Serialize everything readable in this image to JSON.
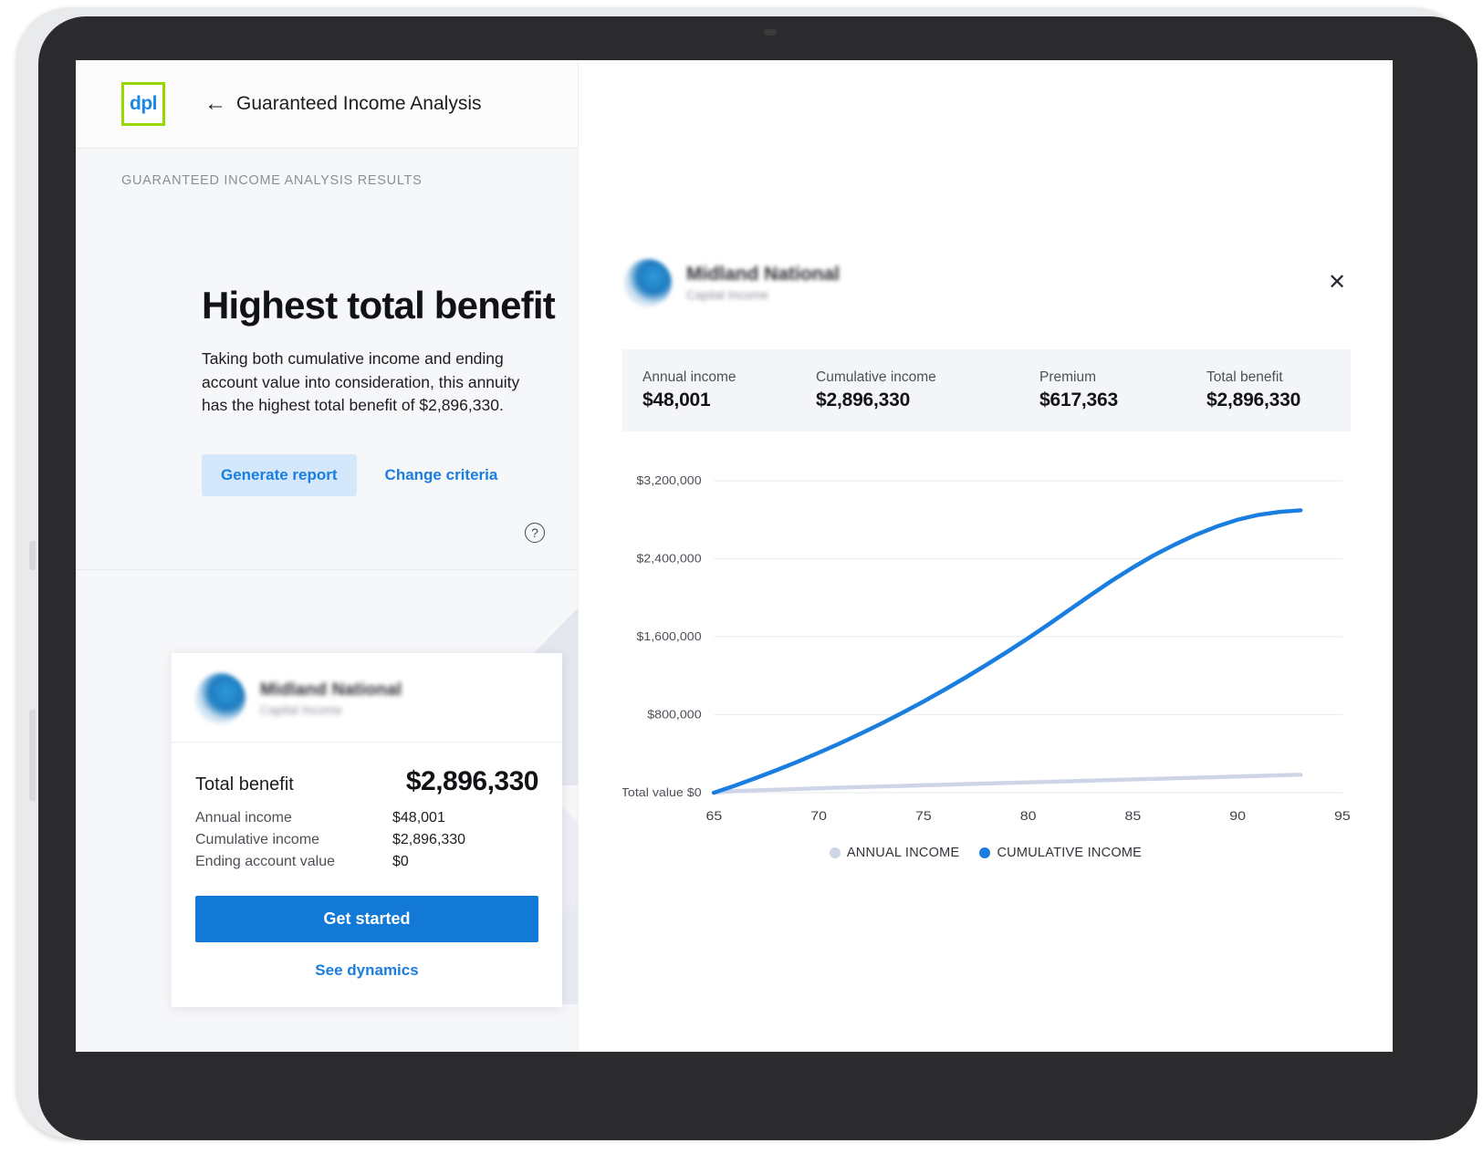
{
  "app": {
    "logo_text": "dpl",
    "back_icon": "arrow-left-icon",
    "title": "Guaranteed Income Analysis",
    "section_label": "GUARANTEED INCOME ANALYSIS RESULTS"
  },
  "hero": {
    "title": "Highest total benefit",
    "description": "Taking both cumulative income and ending account value into consideration, this annuity has the highest total benefit of $2,896,330.",
    "primary_button": "Generate report",
    "secondary_button": "Change criteria",
    "help_icon": "question-mark-icon",
    "help_glyph": "?"
  },
  "product_card": {
    "carrier_name": "Midland National",
    "product_name": "Capital Income",
    "total_label": "Total benefit",
    "total_value": "$2,896,330",
    "rows": [
      {
        "label": "Annual income",
        "value": "$48,001"
      },
      {
        "label": "Cumulative income",
        "value": "$2,896,330"
      },
      {
        "label": "Ending account value",
        "value": "$0"
      }
    ],
    "get_started_label": "Get started",
    "see_dynamics_label": "See dynamics"
  },
  "detail_panel": {
    "close_icon": "close-icon",
    "close_glyph": "✕",
    "carrier_name": "Midland National",
    "product_name": "Capital Income",
    "stats": [
      {
        "label": "Annual income",
        "value": "$48,001"
      },
      {
        "label": "Cumulative income",
        "value": "$2,896,330"
      },
      {
        "label": "Premium",
        "value": "$617,363"
      },
      {
        "label": "Total benefit",
        "value": "$2,896,330"
      }
    ]
  },
  "colors": {
    "accent_blue": "#1279d6",
    "link_blue": "#1a7ee0",
    "pill_blue_bg": "#d4e7fb",
    "logo_green": "#97d700",
    "cumulative_line": "#1a7ee0",
    "annual_line": "#cdd5e6",
    "panel_bg": "#f6f7f9",
    "stats_bg": "#f4f5f8"
  },
  "chart_data": {
    "type": "line",
    "title": "",
    "xlabel": "",
    "ylabel": "",
    "x": [
      65,
      66,
      67,
      68,
      69,
      70,
      71,
      72,
      73,
      74,
      75,
      76,
      77,
      78,
      79,
      80,
      81,
      82,
      83,
      84,
      85,
      86,
      87,
      88,
      89,
      90,
      91,
      92,
      93
    ],
    "xlim": [
      65,
      95
    ],
    "xticks": [
      65,
      70,
      75,
      80,
      85,
      90,
      95
    ],
    "xtick_labels": [
      "65",
      "70",
      "75",
      "80",
      "85",
      "90",
      "95"
    ],
    "ylim": [
      0,
      3200000
    ],
    "yticks": [
      0,
      800000,
      1600000,
      2400000,
      3200000
    ],
    "ytick_labels": [
      "Total value $0",
      "$800,000",
      "$1,600,000",
      "$2,400,000",
      "$3,200,000"
    ],
    "grid": true,
    "legend_position": "bottom",
    "series": [
      {
        "name": "ANNUAL INCOME",
        "color": "#cdd5e6",
        "values": [
          0,
          17000,
          24000,
          31000,
          38000,
          45000,
          52000,
          58000,
          64000,
          70000,
          76000,
          82000,
          88000,
          94000,
          100000,
          106000,
          112000,
          118000,
          124000,
          130000,
          136000,
          142000,
          148000,
          154000,
          160000,
          166000,
          172000,
          178000,
          184000
        ]
      },
      {
        "name": "CUMULATIVE INCOME",
        "color": "#1a7ee0",
        "values": [
          0,
          72000,
          150000,
          232000,
          318000,
          410000,
          505000,
          605000,
          710000,
          820000,
          935000,
          1055000,
          1180000,
          1310000,
          1445000,
          1585000,
          1730000,
          1880000,
          2030000,
          2175000,
          2310000,
          2435000,
          2545000,
          2645000,
          2730000,
          2800000,
          2850000,
          2880000,
          2896330
        ]
      }
    ]
  }
}
